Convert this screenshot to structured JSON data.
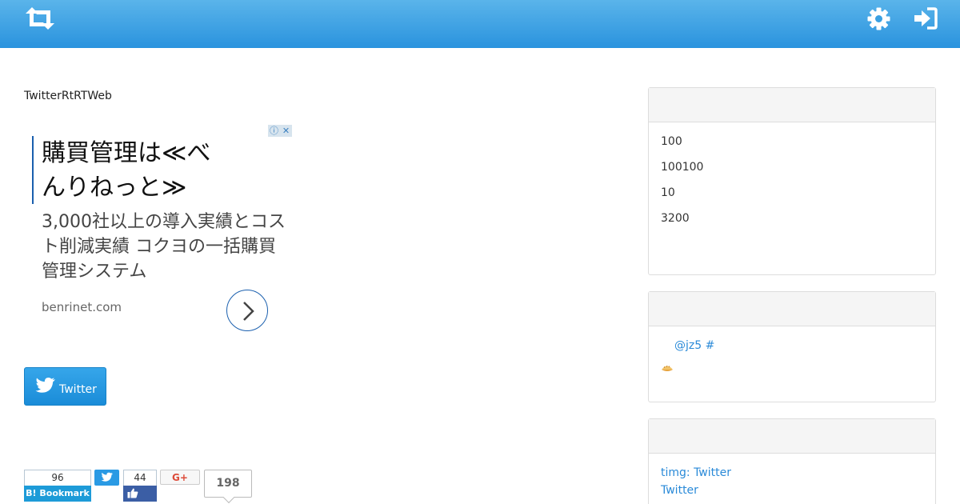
{
  "header": {
    "logo_icon": "retweet-icon",
    "settings_icon": "gear-icon",
    "signin_icon": "sign-in-icon",
    "bar_color": "#2a93de"
  },
  "page": {
    "site_title": "TwitterRtRTWeb"
  },
  "ad": {
    "headline": "購買管理は≪べんりねっと≫",
    "body": "3,000社以上の導入実績とコスト削減実績 コクヨの一括購買管理システム",
    "domain": "benrinet.com",
    "info_icon": "ⓘ",
    "close_icon": "✕"
  },
  "twitter_button": {
    "label": "Twitter"
  },
  "share": {
    "hatena_count": "96",
    "hatena_label": "B! Bookmark",
    "facebook_count": "44",
    "gplus_label": "G+",
    "total_count": "198"
  },
  "sidebar": {
    "panel1": {
      "rows": [
        "100",
        "100100",
        "10",
        "3200"
      ]
    },
    "panel2": {
      "handle": "@jz5 #",
      "emoji_icon": "dumpling-icon"
    },
    "panel3": {
      "links": [
        "timg: Twitter",
        "Twitter"
      ]
    }
  }
}
